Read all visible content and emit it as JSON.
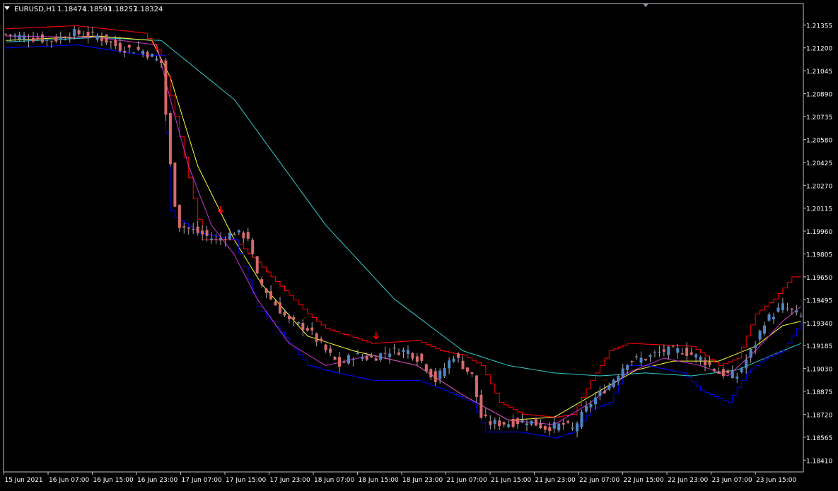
{
  "chart_header": {
    "symbol": "EURUSD,H1",
    "open": "1.18474",
    "high": "1.18591",
    "low": "1.18257",
    "close": "1.18324"
  },
  "colors": {
    "background": "#000000",
    "frame": "#c0c0c0",
    "text": "#ffffff",
    "bull": "#4f86c6",
    "bear": "#d76a6a",
    "wick": "#aaaaaa",
    "envelope_upper": "#ff0000",
    "envelope_lower": "#0000ff",
    "ma_fast": "#cc33cc",
    "ma_mid": "#ffff33",
    "ma_slow": "#33cccc",
    "signal_arrow": "#ff0000"
  },
  "chart_data": {
    "type": "candlestick",
    "timeframe": "H1",
    "ylim": [
      1.1833,
      1.215
    ],
    "y_ticks": [
      "1.21355",
      "1.21200",
      "1.21045",
      "1.20890",
      "1.20735",
      "1.20580",
      "1.20425",
      "1.20270",
      "1.20115",
      "1.19960",
      "1.19805",
      "1.19650",
      "1.19495",
      "1.19340",
      "1.19185",
      "1.19030",
      "1.18875",
      "1.18720",
      "1.18565",
      "1.18410"
    ],
    "x_ticks": [
      "15 Jun 2021",
      "16 Jun 07:00",
      "16 Jun 15:00",
      "16 Jun 23:00",
      "17 Jun 07:00",
      "17 Jun 15:00",
      "17 Jun 23:00",
      "18 Jun 07:00",
      "18 Jun 15:00",
      "18 Jun 23:00",
      "21 Jun 07:00",
      "21 Jun 15:00",
      "21 Jun 23:00",
      "22 Jun 07:00",
      "22 Jun 15:00",
      "22 Jun 23:00",
      "23 Jun 07:00",
      "23 Jun 15:00"
    ],
    "bar_count": 175,
    "candles_close_anchors": [
      [
        0,
        1.2129
      ],
      [
        10,
        1.2125
      ],
      [
        15,
        1.213
      ],
      [
        20,
        1.2128
      ],
      [
        25,
        1.212
      ],
      [
        30,
        1.2118
      ],
      [
        34,
        1.211
      ],
      [
        36,
        1.204
      ],
      [
        37,
        1.2015
      ],
      [
        38,
        1.2
      ],
      [
        42,
        1.1995
      ],
      [
        46,
        1.199
      ],
      [
        50,
        1.1995
      ],
      [
        53,
        1.1992
      ],
      [
        55,
        1.1965
      ],
      [
        58,
        1.195
      ],
      [
        62,
        1.1935
      ],
      [
        66,
        1.193
      ],
      [
        70,
        1.1915
      ],
      [
        73,
        1.1905
      ],
      [
        76,
        1.1912
      ],
      [
        80,
        1.191
      ],
      [
        84,
        1.1915
      ],
      [
        88,
        1.1915
      ],
      [
        91,
        1.1908
      ],
      [
        94,
        1.1895
      ],
      [
        98,
        1.1912
      ],
      [
        102,
        1.1898
      ],
      [
        104,
        1.187
      ],
      [
        106,
        1.1866
      ],
      [
        110,
        1.1866
      ],
      [
        114,
        1.1868
      ],
      [
        118,
        1.1863
      ],
      [
        122,
        1.1865
      ],
      [
        124,
        1.1862
      ],
      [
        128,
        1.188
      ],
      [
        132,
        1.1892
      ],
      [
        136,
        1.1908
      ],
      [
        140,
        1.191
      ],
      [
        144,
        1.1915
      ],
      [
        148,
        1.1915
      ],
      [
        152,
        1.191
      ],
      [
        156,
        1.19
      ],
      [
        160,
        1.1898
      ],
      [
        164,
        1.192
      ],
      [
        166,
        1.1935
      ],
      [
        170,
        1.1945
      ],
      [
        174,
        1.1938
      ]
    ],
    "envelope_upper_anchors": [
      [
        0,
        1.2133
      ],
      [
        15,
        1.2135
      ],
      [
        30,
        1.213
      ],
      [
        34,
        1.2115
      ],
      [
        38,
        1.206
      ],
      [
        43,
        1.199
      ],
      [
        50,
        1.199
      ],
      [
        55,
        1.1975
      ],
      [
        58,
        1.1965
      ],
      [
        66,
        1.194
      ],
      [
        70,
        1.193
      ],
      [
        80,
        1.192
      ],
      [
        90,
        1.1922
      ],
      [
        95,
        1.1915
      ],
      [
        100,
        1.1912
      ],
      [
        104,
        1.1905
      ],
      [
        108,
        1.188
      ],
      [
        113,
        1.1872
      ],
      [
        120,
        1.187
      ],
      [
        124,
        1.1872
      ],
      [
        128,
        1.1895
      ],
      [
        132,
        1.1915
      ],
      [
        136,
        1.192
      ],
      [
        150,
        1.1918
      ],
      [
        156,
        1.1905
      ],
      [
        160,
        1.191
      ],
      [
        164,
        1.194
      ],
      [
        168,
        1.195
      ],
      [
        172,
        1.1965
      ],
      [
        174,
        1.1965
      ]
    ],
    "envelope_lower_anchors": [
      [
        0,
        1.212
      ],
      [
        15,
        1.2122
      ],
      [
        30,
        1.2115
      ],
      [
        34,
        1.2115
      ],
      [
        36,
        1.201
      ],
      [
        37,
        1.2005
      ],
      [
        42,
        1.1995
      ],
      [
        50,
        1.199
      ],
      [
        55,
        1.1945
      ],
      [
        58,
        1.1935
      ],
      [
        62,
        1.192
      ],
      [
        66,
        1.1905
      ],
      [
        72,
        1.19
      ],
      [
        80,
        1.1895
      ],
      [
        90,
        1.1895
      ],
      [
        96,
        1.1888
      ],
      [
        102,
        1.188
      ],
      [
        105,
        1.186
      ],
      [
        112,
        1.186
      ],
      [
        120,
        1.1856
      ],
      [
        124,
        1.186
      ],
      [
        128,
        1.1875
      ],
      [
        132,
        1.188
      ],
      [
        136,
        1.1905
      ],
      [
        140,
        1.1905
      ],
      [
        148,
        1.19
      ],
      [
        152,
        1.1888
      ],
      [
        158,
        1.188
      ],
      [
        162,
        1.19
      ],
      [
        166,
        1.191
      ],
      [
        170,
        1.1915
      ],
      [
        174,
        1.1935
      ]
    ],
    "ma_fast_anchors": [
      [
        0,
        1.2128
      ],
      [
        20,
        1.2127
      ],
      [
        33,
        1.2122
      ],
      [
        36,
        1.2085
      ],
      [
        40,
        1.204
      ],
      [
        45,
        1.2
      ],
      [
        50,
        1.198
      ],
      [
        55,
        1.195
      ],
      [
        62,
        1.192
      ],
      [
        70,
        1.1905
      ],
      [
        80,
        1.1912
      ],
      [
        90,
        1.1905
      ],
      [
        100,
        1.1885
      ],
      [
        110,
        1.1868
      ],
      [
        120,
        1.1865
      ],
      [
        128,
        1.188
      ],
      [
        136,
        1.19
      ],
      [
        144,
        1.191
      ],
      [
        152,
        1.1905
      ],
      [
        158,
        1.1898
      ],
      [
        164,
        1.1915
      ],
      [
        170,
        1.1935
      ],
      [
        174,
        1.1945
      ]
    ],
    "ma_mid_anchors": [
      [
        0,
        1.2125
      ],
      [
        20,
        1.2128
      ],
      [
        32,
        1.2125
      ],
      [
        36,
        1.21
      ],
      [
        42,
        1.204
      ],
      [
        50,
        1.199
      ],
      [
        56,
        1.196
      ],
      [
        66,
        1.1925
      ],
      [
        76,
        1.1915
      ],
      [
        90,
        1.1905
      ],
      [
        100,
        1.1885
      ],
      [
        110,
        1.1868
      ],
      [
        120,
        1.187
      ],
      [
        130,
        1.1888
      ],
      [
        138,
        1.1902
      ],
      [
        146,
        1.1908
      ],
      [
        156,
        1.1908
      ],
      [
        164,
        1.1918
      ],
      [
        170,
        1.1932
      ],
      [
        174,
        1.1935
      ]
    ],
    "ma_slow_anchors": [
      [
        0,
        1.2124
      ],
      [
        20,
        1.2127
      ],
      [
        34,
        1.2125
      ],
      [
        50,
        1.2085
      ],
      [
        70,
        1.2
      ],
      [
        85,
        1.195
      ],
      [
        100,
        1.1915
      ],
      [
        110,
        1.1905
      ],
      [
        120,
        1.19
      ],
      [
        130,
        1.1898
      ],
      [
        140,
        1.19
      ],
      [
        150,
        1.1898
      ],
      [
        160,
        1.1902
      ],
      [
        170,
        1.1915
      ],
      [
        174,
        1.192
      ]
    ],
    "signal_arrows": [
      {
        "bar": 47,
        "price": 1.201,
        "direction": "down"
      },
      {
        "bar": 81,
        "price": 1.1925,
        "direction": "down"
      }
    ],
    "scale_marker_bar": 140
  }
}
